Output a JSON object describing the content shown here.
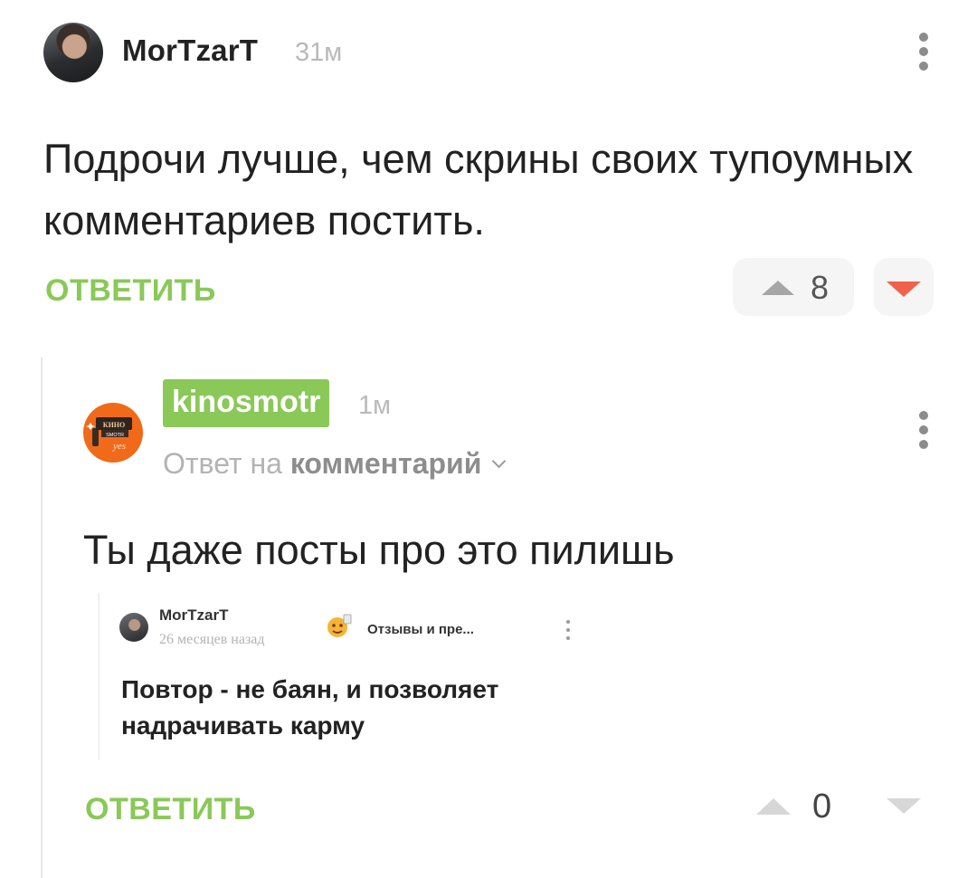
{
  "comment": {
    "author": "MorTzarT",
    "time": "31м",
    "text": "Подрочи лучше, чем скрины своих тупоумных комментариев постить.",
    "reply_label": "ОТВЕТИТЬ",
    "score": "8",
    "icons": {
      "more": "more-vertical-icon",
      "upvote": "upvote-icon",
      "downvote": "downvote-icon"
    },
    "colors": {
      "accent": "#8ac858",
      "downvote_active": "#f0624c"
    }
  },
  "reply": {
    "author": "kinosmotr",
    "time": "1м",
    "reply_to_prefix": "Ответ на",
    "reply_to_link": "комментарий",
    "text": "Ты даже посты про это пилишь",
    "avatar_text": "КИНО SMOTR yes",
    "embed": {
      "author": "MorTzarT",
      "time": "26 месяцев назад",
      "community": "Отзывы и пре...",
      "title": "Повтор - не баян, и позволяет надрачивать карму"
    },
    "reply_label": "ОТВЕТИТЬ",
    "score": "0"
  }
}
